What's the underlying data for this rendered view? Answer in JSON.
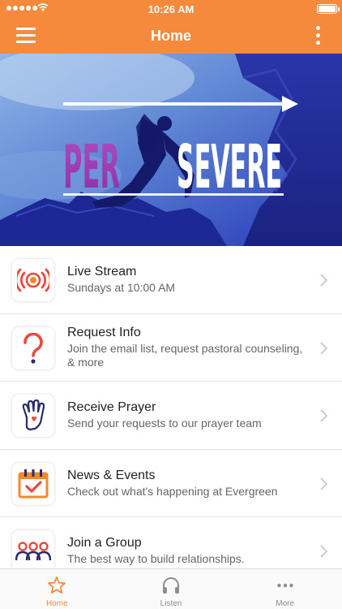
{
  "status_bar": {
    "time": "10:26 AM"
  },
  "header": {
    "title": "Home"
  },
  "hero": {
    "text_left": "PER",
    "text_right": "SEVERE"
  },
  "items": [
    {
      "title": "Live Stream",
      "subtitle": "Sundays at 10:00 AM",
      "icon": "broadcast-icon"
    },
    {
      "title": "Request Info",
      "subtitle": "Join the email list, request pastoral counseling, & more",
      "icon": "question-mark-icon"
    },
    {
      "title": "Receive Prayer",
      "subtitle": "Send your requests to our prayer team",
      "icon": "praying-hand-icon"
    },
    {
      "title": "News & Events",
      "subtitle": "Check out what's happening at Evergreen",
      "icon": "calendar-check-icon"
    },
    {
      "title": "Join a Group",
      "subtitle": "The best way to build relationships.",
      "icon": "group-people-icon"
    }
  ],
  "tabs": [
    {
      "label": "Home",
      "icon": "star-icon",
      "active": true
    },
    {
      "label": "Listen",
      "icon": "headphones-icon",
      "active": false
    },
    {
      "label": "More",
      "icon": "ellipsis-icon",
      "active": false
    }
  ],
  "colors": {
    "accent": "#f68a3c",
    "hero_blue": "#2f3fc4",
    "hero_purple": "#a43fb8"
  }
}
